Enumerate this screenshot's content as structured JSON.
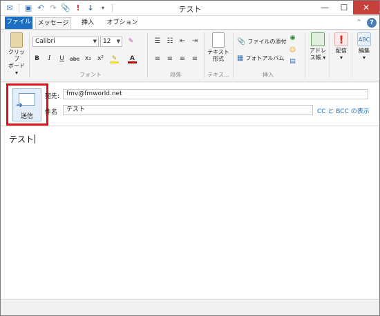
{
  "window": {
    "title": "テスト"
  },
  "quick_access": {
    "icons": [
      "mail-icon",
      "save-icon",
      "undo-icon",
      "redo-icon",
      "attach-icon",
      "priority-high-icon",
      "priority-low-icon",
      "customize-icon"
    ]
  },
  "tabs": {
    "file": "ファイル",
    "message": "メッセージ",
    "insert": "挿入",
    "options": "オプション"
  },
  "ribbon": {
    "clipboard": {
      "paste_line1": "クリップ",
      "paste_line2": "ボード ▾"
    },
    "font": {
      "name": "Calibri",
      "size": "12",
      "group_label": "フォント",
      "buttons": {
        "bold": "B",
        "italic": "I",
        "underline": "U",
        "strike": "abc",
        "subscript": "x₂",
        "superscript": "x²",
        "highlight": "✎",
        "color": "A"
      }
    },
    "paragraph": {
      "group_label": "段落"
    },
    "plaintext": {
      "line1": "テキスト",
      "line2": "形式",
      "group_label": "テキス..."
    },
    "insert": {
      "attach_label": "ファイルの添付",
      "photo_label": "フォトアルバム",
      "group_label": "挿入"
    },
    "addressbook": {
      "line1": "アドレ",
      "line2": "ス帳 ▾"
    },
    "delivery": {
      "line1": "配信",
      "line2": "▾"
    },
    "edit": {
      "line1": "編集",
      "line2": "▾"
    }
  },
  "compose": {
    "send_label": "送信",
    "to_label": "宛先:",
    "to_value": "fmv@fmworld.net",
    "subject_label": "件名",
    "subject_value": "テスト",
    "cc_bcc_link": "CC と BCC の表示",
    "body": "テスト"
  },
  "colors": {
    "accent": "#1b6ec2",
    "highlight_box": "#e0101a",
    "close_button": "#c7413a"
  }
}
